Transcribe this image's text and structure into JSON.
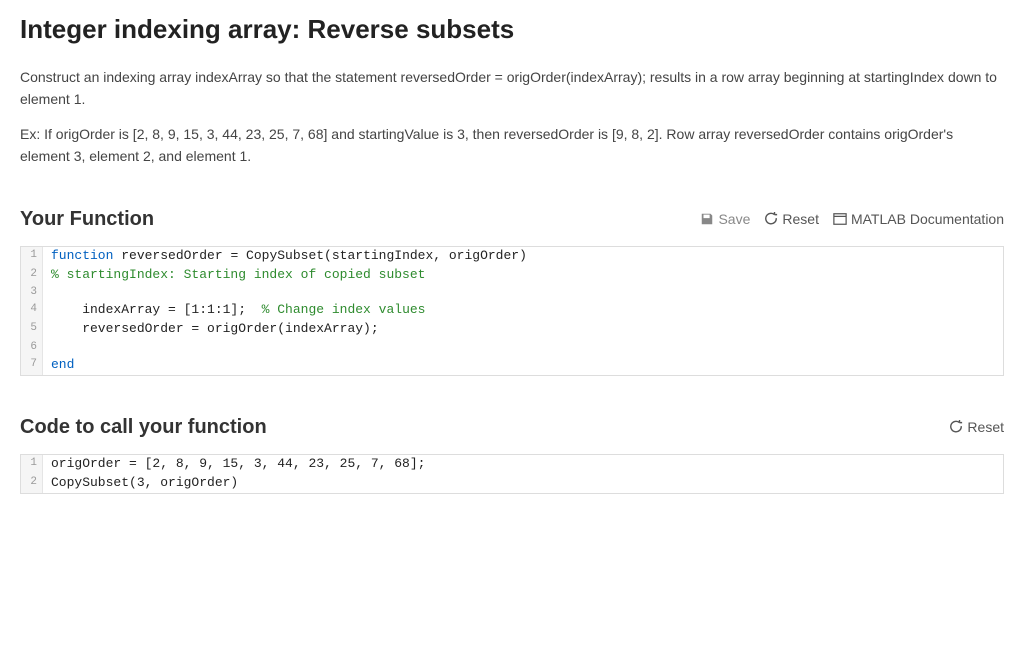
{
  "title": "Integer indexing array: Reverse subsets",
  "desc1": "Construct an indexing array indexArray so that the statement reversedOrder = origOrder(indexArray); results in a row array beginning at startingIndex down to element 1.",
  "desc2": "Ex: If origOrder is [2, 8, 9, 15, 3, 44, 23, 25, 7, 68] and startingValue is 3, then reversedOrder is [9, 8, 2]. Row array reversedOrder contains origOrder's element 3, element 2, and element 1.",
  "yourFunction": {
    "heading": "Your Function",
    "toolbar": {
      "save": "Save",
      "reset": "Reset",
      "docs": "MATLAB Documentation"
    },
    "lines": {
      "l1_kw": "function",
      "l1_rest": " reversedOrder = CopySubset(startingIndex, origOrder)",
      "l2_cm": "% startingIndex: Starting index of copied subset",
      "l3": "",
      "l4_code": "    indexArray = [1:1:1];  ",
      "l4_cm": "% Change index values",
      "l5": "    reversedOrder = origOrder(indexArray);",
      "l6": "",
      "l7_kw": "end"
    }
  },
  "callFunction": {
    "heading": "Code to call your function",
    "toolbar": {
      "reset": "Reset"
    },
    "lines": {
      "l1": "origOrder = [2, 8, 9, 15, 3, 44, 23, 25, 7, 68];",
      "l2": "CopySubset(3, origOrder)"
    }
  }
}
